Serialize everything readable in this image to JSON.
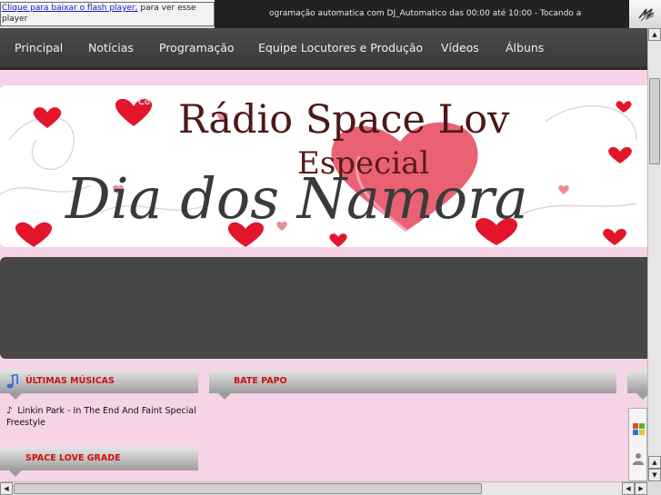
{
  "flash_notice": {
    "link": "Clique para baixar o flash player,",
    "rest": " para ver esse player"
  },
  "ticker": {
    "text": "ogramação automatica com DJ_Automatico das 00:00 até 10:00 - Tocando a"
  },
  "nav": {
    "items": [
      "Principal",
      "Notícias",
      "Programação",
      "Equipe Locutores e Produção",
      "Vídeos",
      "Álbuns"
    ]
  },
  "banner": {
    "small_text": "Co",
    "title_line1": "Rádio Space Lov",
    "title_line2": "Especial",
    "script_line": "Dia dos Namora"
  },
  "panels": {
    "recent_songs": "ÚLTIMAS MÚSICAS",
    "chat": "BATE PAPO",
    "grade": "SPACE LOVE GRADE"
  },
  "recent_songs": {
    "current": "Linkin Park - In The End And Faint Special Freestyle"
  },
  "colors": {
    "page_bg": "#f6d3e6",
    "nav_bg": "#444444",
    "panel_title": "#d01010",
    "banner_title": "#5a1a1a",
    "heart": "#e2152b"
  },
  "icons": {
    "ticker": "wave-logo-icon",
    "music": "music-note-icon",
    "scroll_up": "arrow-up-icon",
    "scroll_down": "arrow-down-icon",
    "scroll_left": "arrow-left-icon",
    "scroll_right": "arrow-right-icon"
  }
}
